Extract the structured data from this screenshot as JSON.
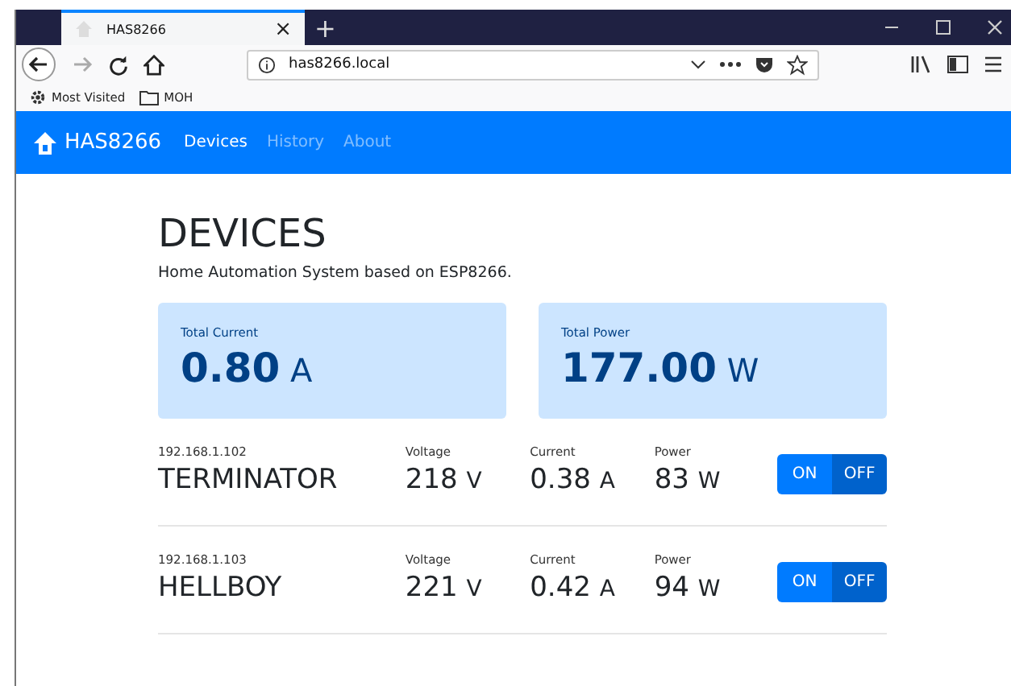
{
  "browser": {
    "tab_title": "HAS8266",
    "tab_close": "×",
    "new_tab": "+",
    "url": "has8266.local",
    "bookmarks": [
      {
        "label": "Most Visited",
        "kind": "gear"
      },
      {
        "label": "MOH",
        "kind": "folder"
      }
    ]
  },
  "navbar": {
    "brand": "HAS8266",
    "links": [
      {
        "label": "Devices",
        "selected": true
      },
      {
        "label": "History",
        "selected": false
      },
      {
        "label": "About",
        "selected": false
      }
    ]
  },
  "page": {
    "title": "DEVICES",
    "subtitle": "Home Automation System based on ESP8266."
  },
  "totals": [
    {
      "label": "Total Current",
      "value": "0.80",
      "unit": "A"
    },
    {
      "label": "Total Power",
      "value": "177.00",
      "unit": "W"
    }
  ],
  "devices": [
    {
      "ip": "192.168.1.102",
      "name": "TERMINATOR",
      "metrics": [
        {
          "label": "Voltage",
          "value": "218",
          "unit": "V"
        },
        {
          "label": "Current",
          "value": "0.38",
          "unit": "A"
        },
        {
          "label": "Power",
          "value": "83",
          "unit": "W"
        }
      ],
      "toggle": [
        {
          "label": "ON",
          "selected": false
        },
        {
          "label": "OFF",
          "selected": true
        }
      ]
    },
    {
      "ip": "192.168.1.103",
      "name": "HELLBOY",
      "metrics": [
        {
          "label": "Voltage",
          "value": "221",
          "unit": "V"
        },
        {
          "label": "Current",
          "value": "0.42",
          "unit": "A"
        },
        {
          "label": "Power",
          "value": "94",
          "unit": "W"
        }
      ],
      "toggle": [
        {
          "label": "ON",
          "selected": false
        },
        {
          "label": "OFF",
          "selected": true
        }
      ]
    }
  ]
}
